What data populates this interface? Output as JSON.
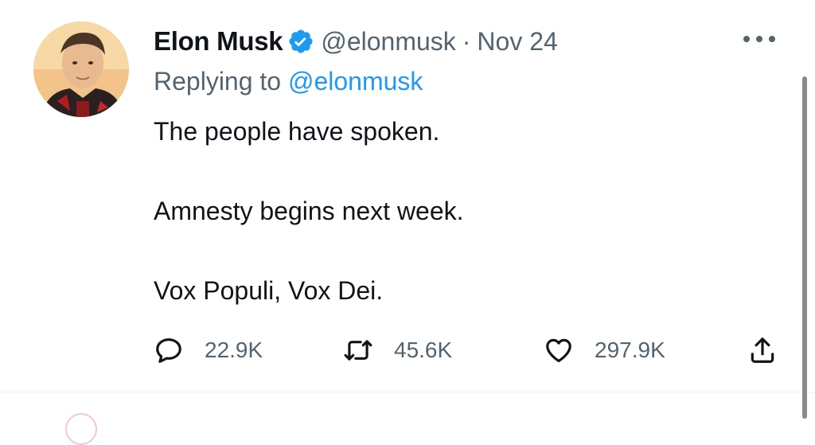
{
  "tweet": {
    "author": {
      "display_name": "Elon Musk",
      "handle": "@elonmusk",
      "verified_icon": "verified-badge-icon",
      "avatar": "profile-photo"
    },
    "separator": "·",
    "date": "Nov 24",
    "more_icon": "more-options-icon",
    "reply_prefix": "Replying to",
    "reply_handle": "@elonmusk",
    "text_paragraphs": [
      "The people have spoken.",
      "Amnesty begins next week.",
      "Vox Populi, Vox Dei."
    ],
    "stats": {
      "replies": "22.9K",
      "retweets": "45.6K",
      "likes": "297.9K"
    },
    "icons": {
      "reply": "reply-icon",
      "retweet": "retweet-icon",
      "like": "like-icon",
      "share": "share-icon"
    }
  },
  "colors": {
    "text": "#0f1419",
    "secondary": "#536471",
    "link": "#1d9bf0",
    "verified": "#1d9bf0"
  }
}
